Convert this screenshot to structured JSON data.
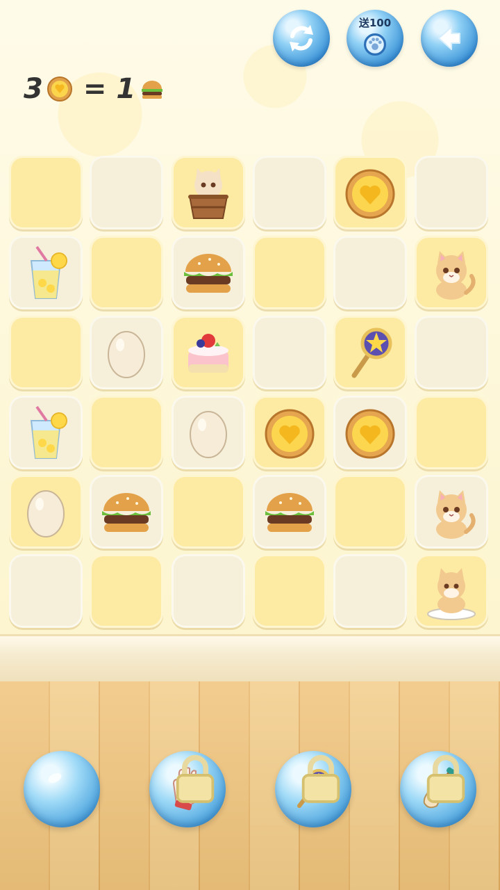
{
  "top_buttons": {
    "refresh_icon": "refresh-icon",
    "gift_label": "送100",
    "gift_icon": "paw-coin-icon",
    "back_icon": "back-arrow-icon"
  },
  "recipe": {
    "left_count": "3",
    "left_item": "egg-tart",
    "equals": "=",
    "right_count": "1",
    "right_item": "burger"
  },
  "board": {
    "rows": 6,
    "cols": 6,
    "cells": [
      [
        "empty",
        "empty",
        "cat-in-bucket",
        "empty",
        "egg-tart",
        "empty"
      ],
      [
        "lemonade",
        "empty",
        "burger",
        "empty",
        "empty",
        "cat"
      ],
      [
        "empty",
        "egg",
        "cake",
        "empty",
        "magic-wand",
        "empty"
      ],
      [
        "lemonade",
        "empty",
        "egg",
        "egg-tart",
        "egg-tart",
        "empty"
      ],
      [
        "egg",
        "burger",
        "empty",
        "burger",
        "empty",
        "cat"
      ],
      [
        "empty",
        "empty",
        "empty",
        "empty",
        "empty",
        "cat-on-plate"
      ]
    ],
    "colors": [
      [
        "y",
        "c",
        "y",
        "c",
        "y",
        "c"
      ],
      [
        "c",
        "y",
        "c",
        "y",
        "c",
        "y"
      ],
      [
        "y",
        "c",
        "y",
        "c",
        "y",
        "c"
      ],
      [
        "c",
        "y",
        "c",
        "y",
        "c",
        "y"
      ],
      [
        "y",
        "c",
        "y",
        "c",
        "y",
        "c"
      ],
      [
        "c",
        "y",
        "c",
        "y",
        "c",
        "y"
      ]
    ]
  },
  "tools": [
    {
      "name": "empty-bubble",
      "icon": "bubble-icon",
      "locked": false
    },
    {
      "name": "glove",
      "icon": "glove-icon",
      "locked": true
    },
    {
      "name": "magic-wand",
      "icon": "magic-wand-icon",
      "locked": true
    },
    {
      "name": "shovel",
      "icon": "shovel-icon",
      "locked": true
    }
  ],
  "colors": {
    "cell_yellow": "#fdeaa3",
    "cell_cream": "#f6f0db",
    "bubble_blue": "#3c94d8",
    "floor": "#f0c47c"
  }
}
